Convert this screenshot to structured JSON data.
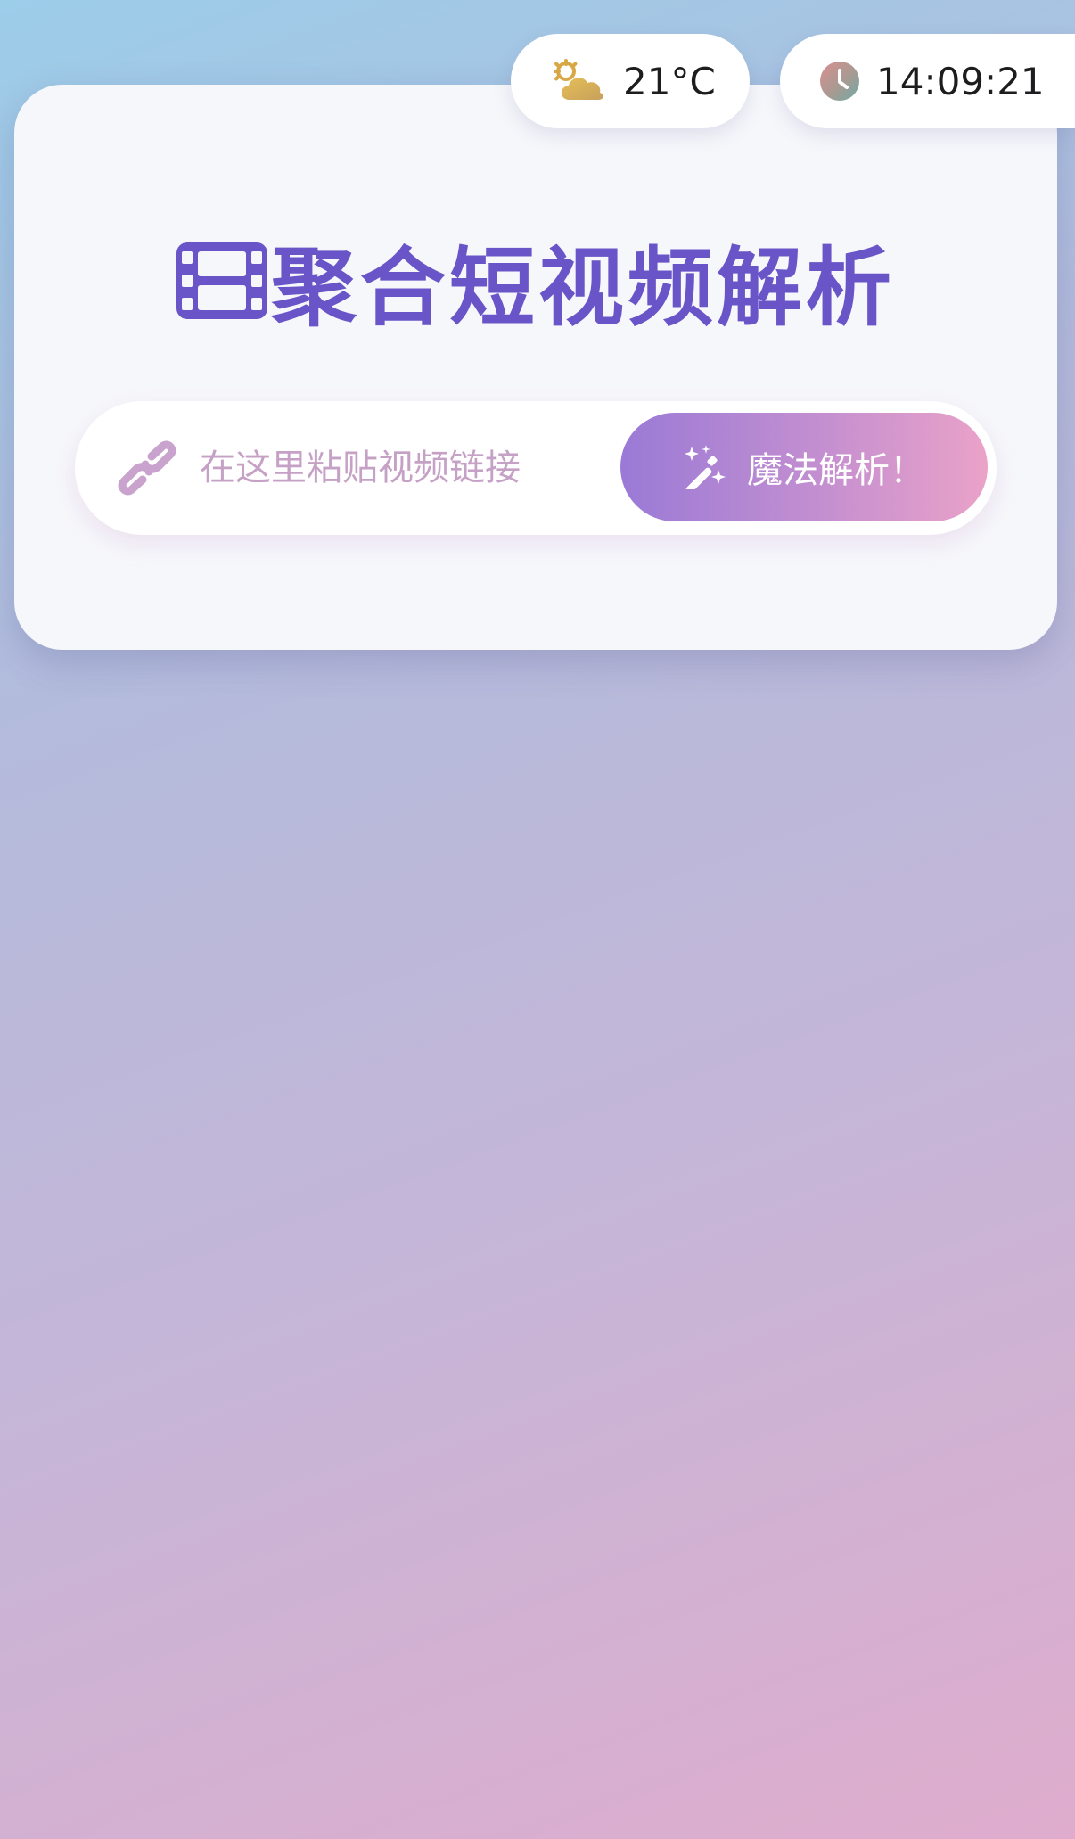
{
  "header": {
    "weather": {
      "icon": "partly-cloudy-icon",
      "temperature": "21°C"
    },
    "clock": {
      "icon": "clock-icon",
      "time": "14:09:21"
    }
  },
  "main": {
    "title_icon": "film-icon",
    "title": "聚合短视频解析",
    "search": {
      "icon": "link-icon",
      "placeholder": "在这里粘贴视频链接",
      "value": ""
    },
    "parse_button": {
      "icon": "magic-wand-icon",
      "label": "魔法解析！"
    }
  },
  "colors": {
    "title": "#6a55c8",
    "button_start": "#9a7ad6",
    "button_end": "#eaa2c8",
    "placeholder": "#c6a1c6",
    "card": "#f6f7fb"
  }
}
